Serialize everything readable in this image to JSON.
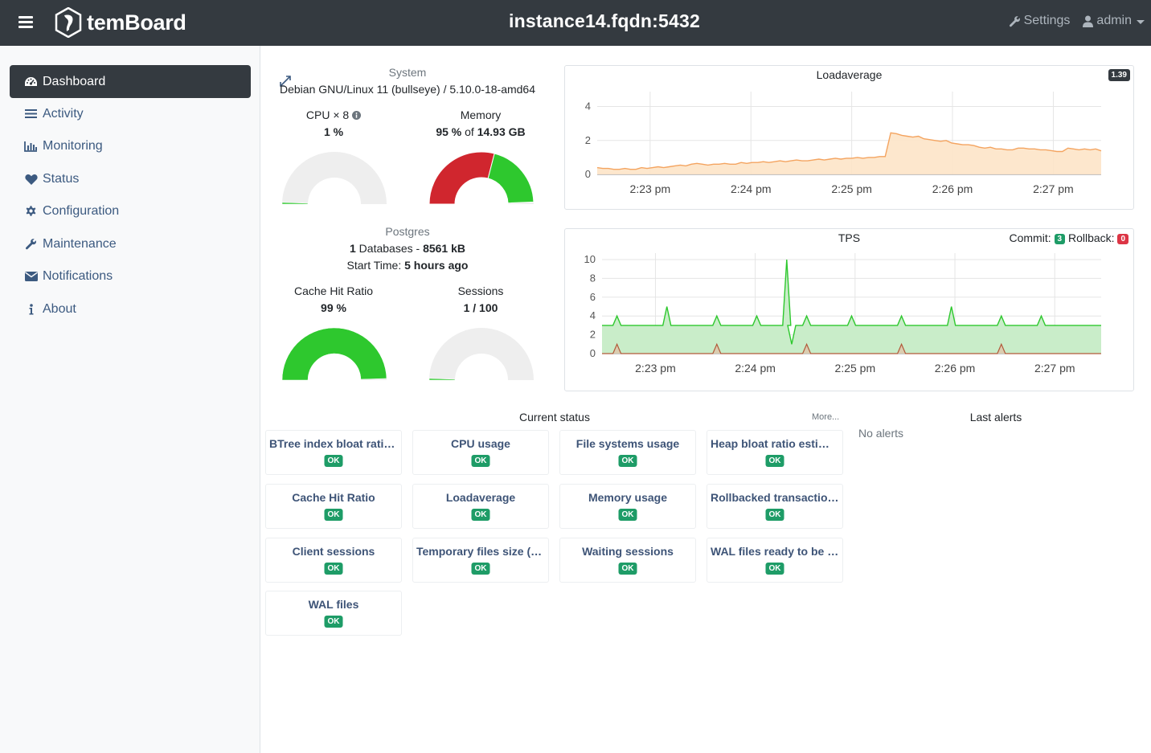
{
  "header": {
    "logo_text": "temBoard",
    "instance": "instance14.fqdn:5432",
    "settings_label": "Settings",
    "user_label": "admin"
  },
  "sidebar": {
    "items": [
      {
        "label": "Dashboard",
        "icon": "dashboard-icon",
        "active": true
      },
      {
        "label": "Activity",
        "icon": "list-icon"
      },
      {
        "label": "Monitoring",
        "icon": "bar-chart-icon"
      },
      {
        "label": "Status",
        "icon": "heart-icon"
      },
      {
        "label": "Configuration",
        "icon": "gear-icon"
      },
      {
        "label": "Maintenance",
        "icon": "wrench-icon"
      },
      {
        "label": "Notifications",
        "icon": "envelope-icon"
      },
      {
        "label": "About",
        "icon": "info-icon"
      }
    ]
  },
  "system": {
    "title": "System",
    "os": "Debian GNU/Linux 11 (bullseye) / 5.10.0-18-amd64",
    "cpu_label": "CPU × 8",
    "cpu_value": "1 %",
    "cpu_percent": 1,
    "memory_label": "Memory",
    "memory_percent_text": "95 %",
    "memory_of": " of ",
    "memory_total": "14.93 GB",
    "memory_percent": 95
  },
  "postgres": {
    "title": "Postgres",
    "databases_count": "1",
    "databases_label": " Databases - ",
    "databases_size": "8561 kB",
    "start_label": "Start Time: ",
    "start_value": "5 hours ago",
    "cache_label": "Cache Hit Ratio",
    "cache_value": "99 %",
    "cache_percent": 99,
    "sessions_label": "Sessions",
    "sessions_value": "1 / 100",
    "sessions_percent": 1
  },
  "loadaverage": {
    "title": "Loadaverage",
    "current": "1.39",
    "y_ticks": [
      "4",
      "2",
      "0"
    ],
    "x_ticks": [
      "2:23 pm",
      "2:24 pm",
      "2:25 pm",
      "2:26 pm",
      "2:27 pm"
    ],
    "color": "#f4a460"
  },
  "tps": {
    "title": "TPS",
    "commit_label": "Commit:",
    "commit_value": "3",
    "rollback_label": "Rollback:",
    "rollback_value": "0",
    "y_ticks": [
      "10",
      "8",
      "6",
      "4",
      "2",
      "0"
    ],
    "x_ticks": [
      "2:23 pm",
      "2:24 pm",
      "2:25 pm",
      "2:26 pm",
      "2:27 pm"
    ],
    "commit_color": "#2ec82e",
    "rollback_color": "#b25a3a"
  },
  "chart_data": [
    {
      "type": "area",
      "title": "Loadaverage",
      "x_ticks": [
        "2:23 pm",
        "2:24 pm",
        "2:25 pm",
        "2:26 pm",
        "2:27 pm"
      ],
      "ylim": [
        0,
        4.5
      ],
      "series": [
        {
          "values": [
            0.4,
            0.35,
            0.35,
            0.3,
            0.3,
            0.35,
            0.3,
            0.3,
            0.4,
            0.35,
            0.4,
            0.45,
            0.4,
            0.45,
            0.5,
            0.55,
            0.5,
            0.6,
            0.65,
            0.6,
            0.55,
            0.6,
            0.6,
            0.65,
            0.6,
            0.6,
            0.7,
            0.65,
            0.7,
            0.7,
            0.75,
            0.7,
            0.75,
            0.8,
            0.75,
            0.8,
            0.85,
            0.8,
            0.8,
            0.85,
            0.9,
            0.85,
            0.9,
            0.95,
            0.9,
            0.95,
            0.95,
            1.0,
            0.95,
            1.0,
            1.0,
            1.05,
            1.05,
            2.45,
            2.4,
            2.3,
            2.25,
            2.2,
            2.25,
            2.1,
            2.05,
            2.0,
            1.95,
            2.0,
            1.85,
            1.8,
            1.75,
            1.75,
            1.7,
            1.6,
            1.55,
            1.6,
            1.5,
            1.5,
            1.45,
            1.45,
            1.55,
            1.55,
            1.5,
            1.5,
            1.45,
            1.45,
            1.4,
            1.35,
            1.35,
            1.55,
            1.5,
            1.45,
            1.5,
            1.45,
            1.5,
            1.39
          ]
        }
      ]
    },
    {
      "type": "area",
      "title": "TPS",
      "x_ticks": [
        "2:23 pm",
        "2:24 pm",
        "2:25 pm",
        "2:26 pm",
        "2:27 pm"
      ],
      "ylim": [
        0,
        10
      ],
      "series": [
        {
          "name": "Commit",
          "baseline": 3,
          "spikes": [
            [
              0.03,
              4
            ],
            [
              0.13,
              5
            ],
            [
              0.23,
              4
            ],
            [
              0.31,
              4
            ],
            [
              0.37,
              10
            ],
            [
              0.38,
              1
            ],
            [
              0.41,
              4
            ],
            [
              0.5,
              4
            ],
            [
              0.6,
              4
            ],
            [
              0.7,
              5
            ],
            [
              0.8,
              4
            ],
            [
              0.88,
              4
            ]
          ],
          "last": 3
        },
        {
          "name": "Rollback",
          "baseline": 0,
          "spikes": [
            [
              0.03,
              1
            ],
            [
              0.23,
              1
            ],
            [
              0.41,
              1
            ],
            [
              0.6,
              1
            ],
            [
              0.8,
              1
            ]
          ],
          "last": 0
        }
      ]
    }
  ],
  "status": {
    "title": "Current status",
    "more_label": "More...",
    "items": [
      {
        "name": "BTree index bloat ratio estimation",
        "state": "OK"
      },
      {
        "name": "CPU usage",
        "state": "OK"
      },
      {
        "name": "File systems usage",
        "state": "OK"
      },
      {
        "name": "Heap bloat ratio estimation",
        "state": "OK"
      },
      {
        "name": "Cache Hit Ratio",
        "state": "OK"
      },
      {
        "name": "Loadaverage",
        "state": "OK"
      },
      {
        "name": "Memory usage",
        "state": "OK"
      },
      {
        "name": "Rollbacked transactions",
        "state": "OK"
      },
      {
        "name": "Client sessions",
        "state": "OK"
      },
      {
        "name": "Temporary files size (delta)",
        "state": "OK"
      },
      {
        "name": "Waiting sessions",
        "state": "OK"
      },
      {
        "name": "WAL files ready to be archived",
        "state": "OK"
      },
      {
        "name": "WAL files",
        "state": "OK"
      }
    ]
  },
  "alerts": {
    "title": "Last alerts",
    "empty": "No alerts"
  },
  "colors": {
    "gauge_green": "#2ec82e",
    "gauge_red": "#d0262e",
    "gauge_gray": "#eeeeee",
    "ok": "#1e9c67"
  }
}
